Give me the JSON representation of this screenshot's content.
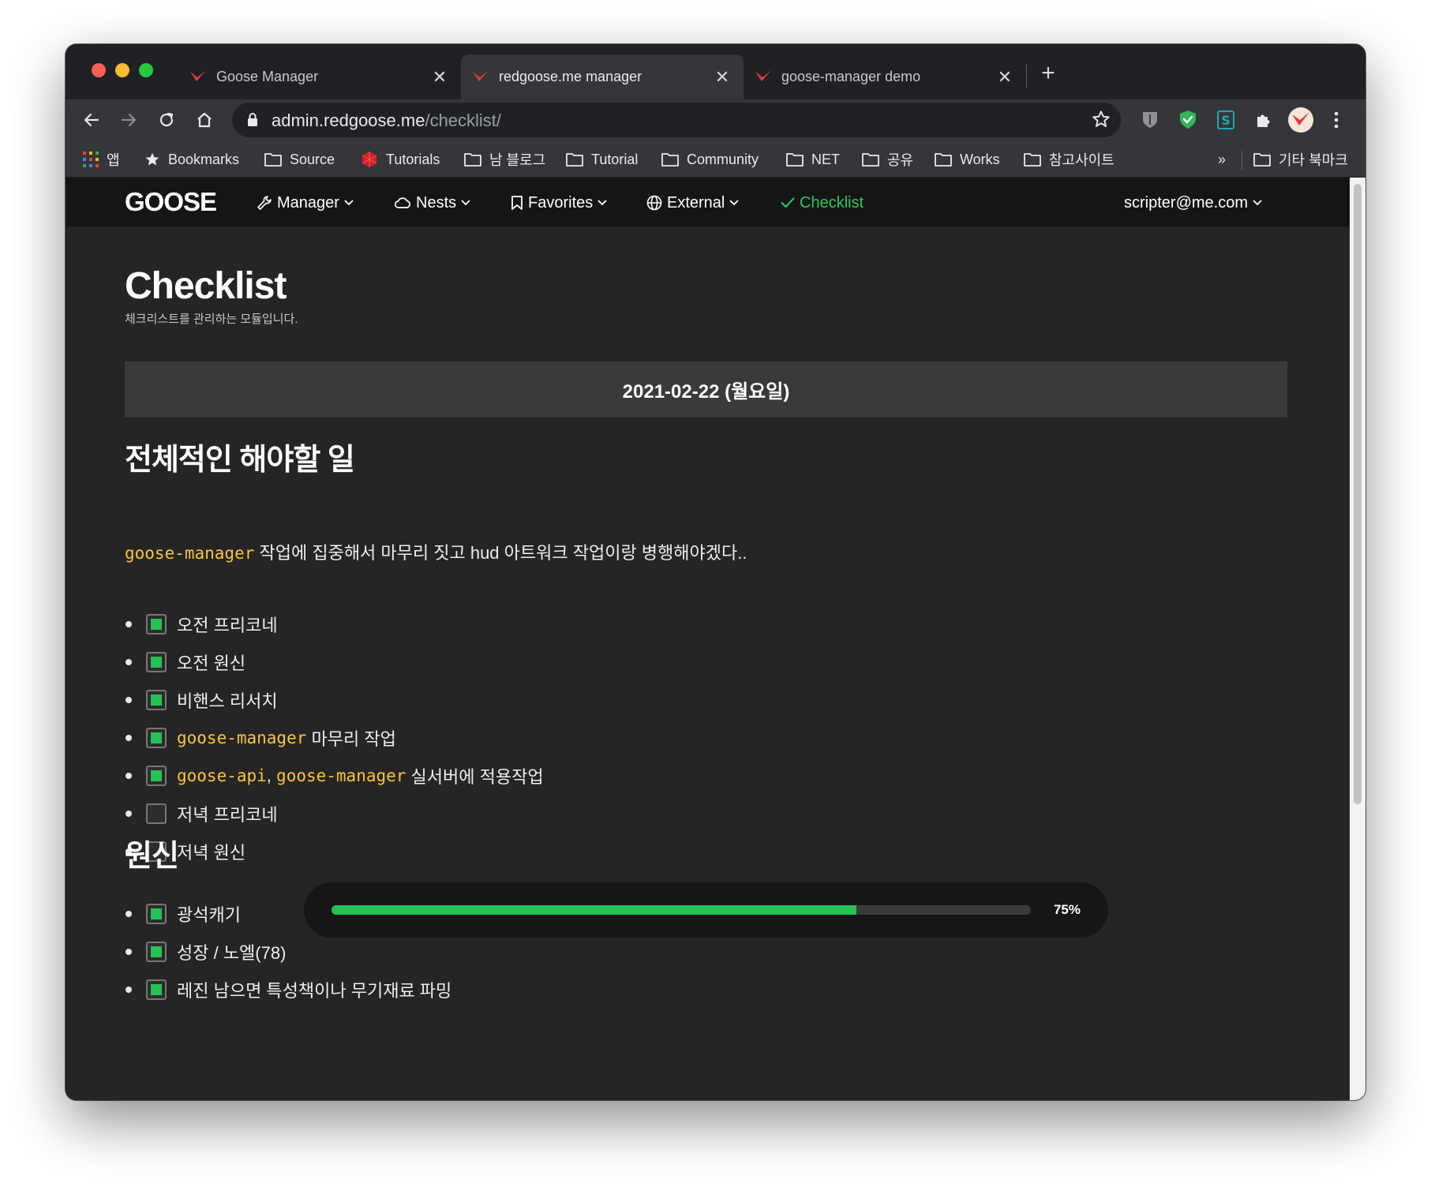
{
  "browser": {
    "tabs": [
      {
        "title": "Goose Manager",
        "active": false
      },
      {
        "title": "redgoose.me manager",
        "active": true
      },
      {
        "title": "goose-manager demo",
        "active": false
      }
    ],
    "close_glyph": "✕",
    "newtab_glyph": "+",
    "address": {
      "domain": "admin.redgoose.me",
      "path": "/checklist/"
    },
    "bookmarks": [
      {
        "label": "앱",
        "icon": "apps-grid-icon"
      },
      {
        "label": "Bookmarks",
        "icon": "star-icon"
      },
      {
        "label": "Source",
        "icon": "folder-icon"
      },
      {
        "label": "Tutorials",
        "icon": "ruby-icon"
      },
      {
        "label": "남 블로그",
        "icon": "folder-icon"
      },
      {
        "label": "Tutorial",
        "icon": "folder-icon"
      },
      {
        "label": "Community",
        "icon": "folder-icon"
      },
      {
        "label": "NET",
        "icon": "folder-icon"
      },
      {
        "label": "공유",
        "icon": "folder-icon"
      },
      {
        "label": "Works",
        "icon": "folder-icon"
      },
      {
        "label": "참고사이트",
        "icon": "folder-icon"
      }
    ],
    "overflow_label": "»",
    "other_bookmarks": "기타 북마크"
  },
  "site": {
    "logo": "GOOSE",
    "nav": [
      {
        "label": "Manager",
        "icon": "wrench-icon"
      },
      {
        "label": "Nests",
        "icon": "cloud-icon"
      },
      {
        "label": "Favorites",
        "icon": "bookmark-icon"
      },
      {
        "label": "External",
        "icon": "globe-icon"
      },
      {
        "label": "Checklist",
        "icon": "check-icon"
      }
    ],
    "user": "scripter@me.com"
  },
  "page": {
    "title": "Checklist",
    "description": "체크리스트를 관리하는 모듈입니다.",
    "date": "2021-02-22 (월요일)",
    "section1": {
      "heading": "전체적인 해야할 일",
      "intro_code": "goose-manager",
      "intro_text": "작업에 집중해서 마무리 짓고 hud 아트워크 작업이랑 병행해야겠다..",
      "items": [
        {
          "checked": true,
          "text": "오전 프리코네"
        },
        {
          "checked": true,
          "text": "오전 원신"
        },
        {
          "checked": true,
          "text": "비핸스 리서치"
        },
        {
          "checked": true,
          "code1": "goose-manager",
          "text": "마무리 작업"
        },
        {
          "checked": true,
          "code1": "goose-api",
          "sep": ",",
          "code2": "goose-manager",
          "text": "실서버에 적용작업"
        },
        {
          "checked": false,
          "text": "저녁 프리코네"
        },
        {
          "checked": false,
          "text": "저녁 원신"
        }
      ]
    },
    "section2": {
      "heading": "원신",
      "items": [
        {
          "checked": true,
          "text": "광석캐기"
        },
        {
          "checked": true,
          "text": "성장 / 노엘(78)"
        },
        {
          "checked": true,
          "text": "레진 남으면 특성책이나 무기재료 파밍"
        }
      ]
    },
    "progress": {
      "value": 0.75,
      "label": "75%"
    }
  },
  "colors": {
    "accent_green": "#25c254",
    "code_yellow": "#f8c53b",
    "nav_bg": "#151515",
    "page_bg": "#252525"
  }
}
